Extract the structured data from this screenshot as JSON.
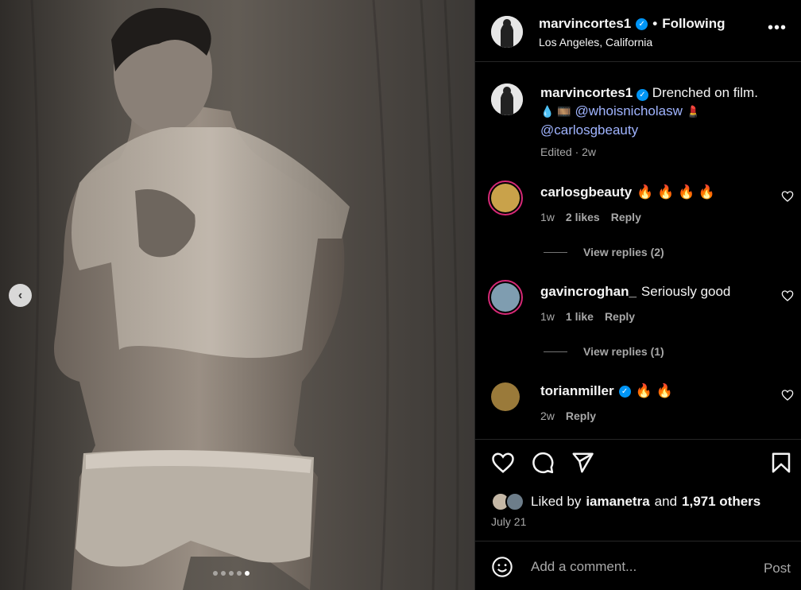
{
  "post": {
    "owner": {
      "username": "marvincortes1",
      "verified_mark": "✓",
      "separator": "•",
      "follow_label": "Following",
      "location": "Los Angeles, California",
      "more_label": "•••"
    },
    "caption": {
      "username": "marvincortes1",
      "text": "Drenched on film.",
      "emojis_1": "💧 🎞️",
      "mention_1": "@whoisnicholasw",
      "emoji_2": "💄",
      "mention_2": "@carlosgbeauty",
      "meta": "Edited · 2w"
    },
    "carousel": {
      "prev_label": "‹",
      "dot_count": 5,
      "active_index": 4
    }
  },
  "comments": [
    {
      "username": "carlosgbeauty",
      "verified": false,
      "text": "🔥 🔥 🔥 🔥",
      "time": "1w",
      "likes": "2 likes",
      "reply": "Reply",
      "replies": "View replies (2)",
      "avatar_color": "#c9a24a"
    },
    {
      "username": "gavincroghan_",
      "verified": false,
      "text": "Seriously good",
      "time": "1w",
      "likes": "1 like",
      "reply": "Reply",
      "replies": "View replies (1)",
      "avatar_color": "#7f9db0"
    },
    {
      "username": "torianmiller",
      "verified": true,
      "text": "🔥 🔥",
      "time": "2w",
      "likes": "",
      "reply": "Reply",
      "replies": "",
      "avatar_color": "#9a7a3a"
    }
  ],
  "engagement": {
    "liked_by_prefix": "Liked by",
    "liked_by_user": "iamanetra",
    "and": "and",
    "others": "1,971 others",
    "date": "July 21"
  },
  "composer": {
    "placeholder": "Add a comment...",
    "post_label": "Post"
  },
  "colors": {
    "verified": "#0095f6",
    "mention": "#a0b4ff",
    "story_ring": "#d62976",
    "muted_text": "#a8a8a8"
  },
  "icons": [
    "chevron-left-icon",
    "more-icon",
    "heart-icon",
    "comment-icon",
    "share-icon",
    "bookmark-icon",
    "emoji-icon",
    "verified-icon"
  ]
}
